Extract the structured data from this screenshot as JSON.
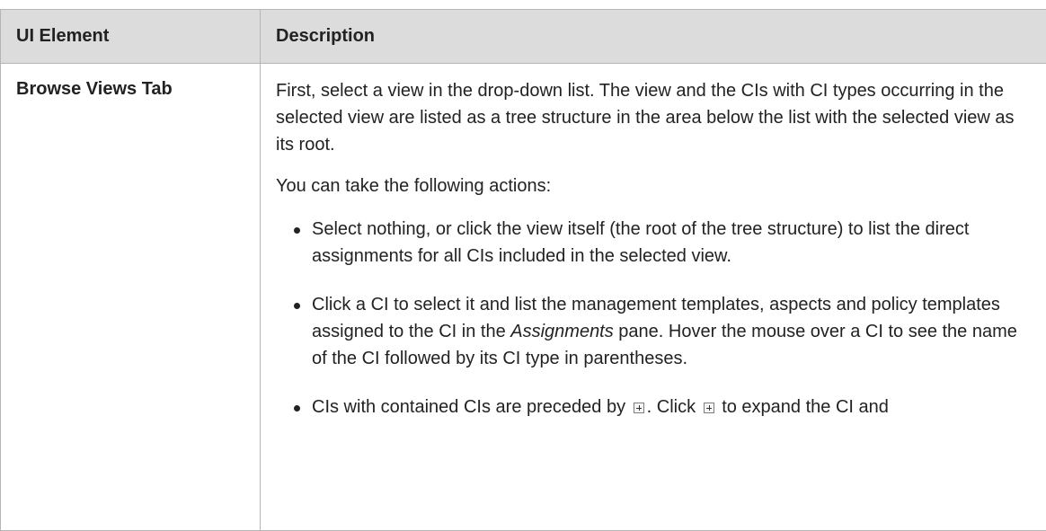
{
  "table": {
    "headers": {
      "element": "UI Element",
      "description": "Description"
    },
    "row": {
      "element": "Browse Views Tab",
      "paragraphs": [
        "First, select a view in the drop-down list. The view and the CIs with CI types occurring in the selected view are listed as a tree structure in the area below the list with the selected view as its root.",
        "You can take the following actions:"
      ],
      "bullets": {
        "b1": "Select nothing, or click the view itself (the root of the tree structure) to list the direct assignments for all CIs included in the selected view.",
        "b2_pre": "Click a CI to select it and list the management templates, aspects and policy templates assigned to the CI in the ",
        "b2_italic": "Assignments",
        "b2_post": " pane. Hover the mouse over a CI to see the name of the CI followed by its CI type in parentheses.",
        "b3_pre": "CIs with contained  CIs are preceded by ",
        "b3_mid": ". Click ",
        "b3_post": " to expand the CI and"
      },
      "icons": {
        "expand": "expand-plus-icon"
      }
    }
  }
}
